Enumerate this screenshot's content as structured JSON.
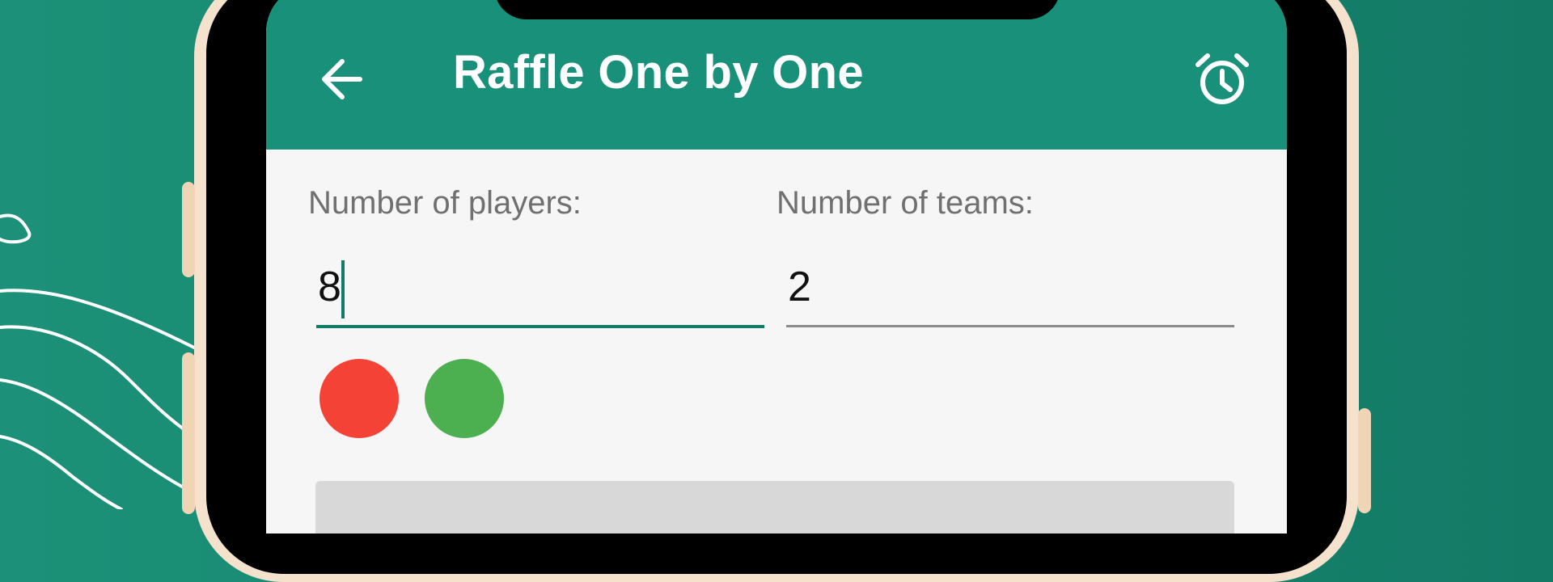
{
  "appbar": {
    "title": "Raffle One by One",
    "back_icon": "arrow-left-icon",
    "alarm_icon": "alarm-clock-icon",
    "color": "#19907a"
  },
  "form": {
    "players_label": "Number of players:",
    "players_value": "8",
    "teams_label": "Number of teams:",
    "teams_value": "2"
  },
  "team_colors": [
    {
      "name": "red",
      "hex": "#f44336"
    },
    {
      "name": "green",
      "hex": "#4caf50"
    }
  ],
  "theme": {
    "background": "#1c9078",
    "phone_frame": "#f4e2cc",
    "accent": "#127a66"
  }
}
